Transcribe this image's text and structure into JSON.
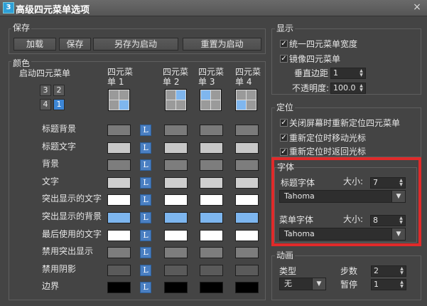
{
  "window": {
    "icon_label": "3",
    "title": "高级四元菜单选项",
    "close_label": "×"
  },
  "save": {
    "group_label": "保存",
    "buttons": {
      "load": "加载",
      "save": "保存",
      "save_as_startup": "另存为启动",
      "reset_to_startup": "重置为启动"
    }
  },
  "colors": {
    "group_label": "颜色",
    "start_quad_label": "启动四元菜单",
    "quad_numbers": [
      "3",
      "2",
      "4",
      "1"
    ],
    "quad_headers": [
      "四元菜\n单 1",
      "四元菜\n单 2",
      "四元菜\n单 3",
      "四元菜\n单 4"
    ],
    "l_label": "L",
    "rows": [
      {
        "label": "标题背景",
        "colors": [
          "#7a7a7a",
          "#7a7a7a",
          "#7a7a7a",
          "#7a7a7a"
        ]
      },
      {
        "label": "标题文字",
        "colors": [
          "#c8c8c8",
          "#c8c8c8",
          "#c8c8c8",
          "#c8c8c8"
        ]
      },
      {
        "label": "背景",
        "colors": [
          "#7d7d7d",
          "#7d7d7d",
          "#7d7d7d",
          "#7d7d7d"
        ]
      },
      {
        "label": "文字",
        "colors": [
          "#cfcfcf",
          "#cfcfcf",
          "#cfcfcf",
          "#cfcfcf"
        ]
      },
      {
        "label": "突出显示的文字",
        "colors": [
          "#ffffff",
          "#ffffff",
          "#ffffff",
          "#ffffff"
        ]
      },
      {
        "label": "突出显示的背景",
        "colors": [
          "#7db6ef",
          "#7db6ef",
          "#7db6ef",
          "#7db6ef"
        ]
      },
      {
        "label": "最后使用的文字",
        "colors": [
          "#ffffff",
          "#ffffff",
          "#ffffff",
          "#ffffff"
        ]
      },
      {
        "label": "禁用突出显示",
        "colors": [
          "#7d7d7d",
          "#7d7d7d",
          "#7d7d7d",
          "#7d7d7d"
        ]
      },
      {
        "label": "禁用阴影",
        "colors": [
          "#5a5a5a",
          "#5a5a5a",
          "#5a5a5a",
          "#5a5a5a"
        ]
      },
      {
        "label": "边界",
        "colors": [
          "#000000",
          "#000000",
          "#000000",
          "#000000"
        ]
      }
    ]
  },
  "display": {
    "group_label": "显示",
    "uniform_width": "统一四元菜单宽度",
    "uniform_width_checked": true,
    "mirror": "镜像四元菜单",
    "mirror_checked": true,
    "vertical_margin_label": "垂直边距",
    "vertical_margin": "1",
    "opacity_label": "不透明度:",
    "opacity": "100.0"
  },
  "positioning": {
    "group_label": "定位",
    "options": [
      {
        "label": "关闭屏幕时重新定位四元菜单",
        "checked": true
      },
      {
        "label": "重新定位时移动光标",
        "checked": true
      },
      {
        "label": "重新定位时返回光标",
        "checked": true
      }
    ]
  },
  "fonts": {
    "group_label": "字体",
    "title_font_label": "标题字体",
    "title_size_label": "大小:",
    "title_size": "7",
    "title_font": "Tahoma",
    "menu_font_label": "菜单字体",
    "menu_size_label": "大小:",
    "menu_size": "8",
    "menu_font": "Tahoma"
  },
  "animation": {
    "group_label": "动画",
    "type_label": "类型",
    "type_value": "无",
    "steps_label": "步数",
    "steps": "2",
    "pause_label": "暂停",
    "pause": "1"
  },
  "highlight_color": "#e02a2a",
  "accent_color": "#4a7fc2"
}
